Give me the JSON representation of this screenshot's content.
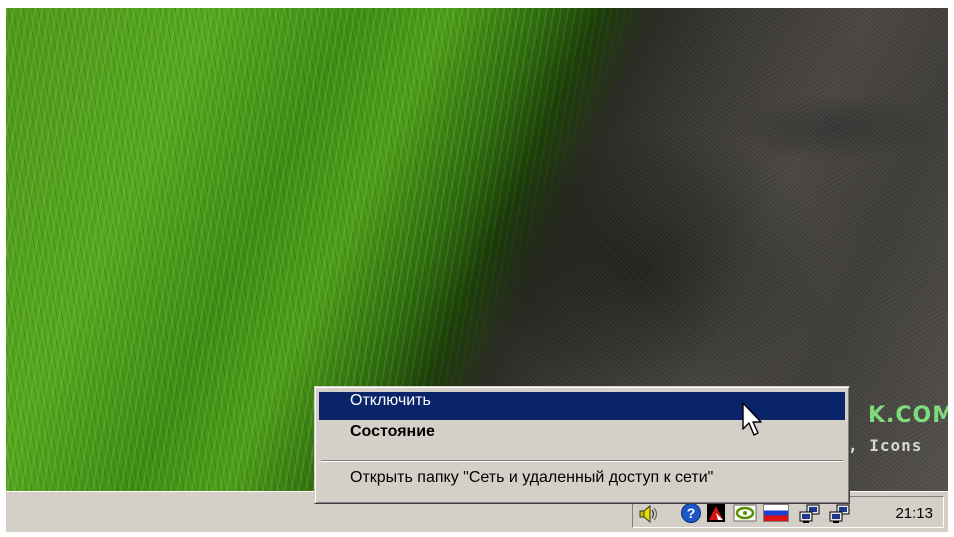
{
  "desktop": {
    "watermark_main": "K.COM",
    "watermark_sub": ", Icons"
  },
  "context_menu": {
    "items": [
      {
        "label": "Отключить",
        "highlighted": true,
        "bold": false
      },
      {
        "label": "Состояние",
        "highlighted": false,
        "bold": true
      },
      {
        "label": "Открыть папку \"Сеть и удаленный доступ к сети\"",
        "highlighted": false,
        "bold": false
      }
    ]
  },
  "taskbar": {
    "tray_icons": [
      "speaker-icon",
      "help-icon",
      "kaspersky-icon",
      "nvidia-icon",
      "language-flag-icon",
      "network-connection-icon",
      "network-connection-icon"
    ],
    "clock": "21:13"
  },
  "colors": {
    "menu_highlight": "#0a246a",
    "menu_background": "#d4d0c8",
    "taskbar_background": "#d4d0c8",
    "watermark": "#7ee07e"
  }
}
